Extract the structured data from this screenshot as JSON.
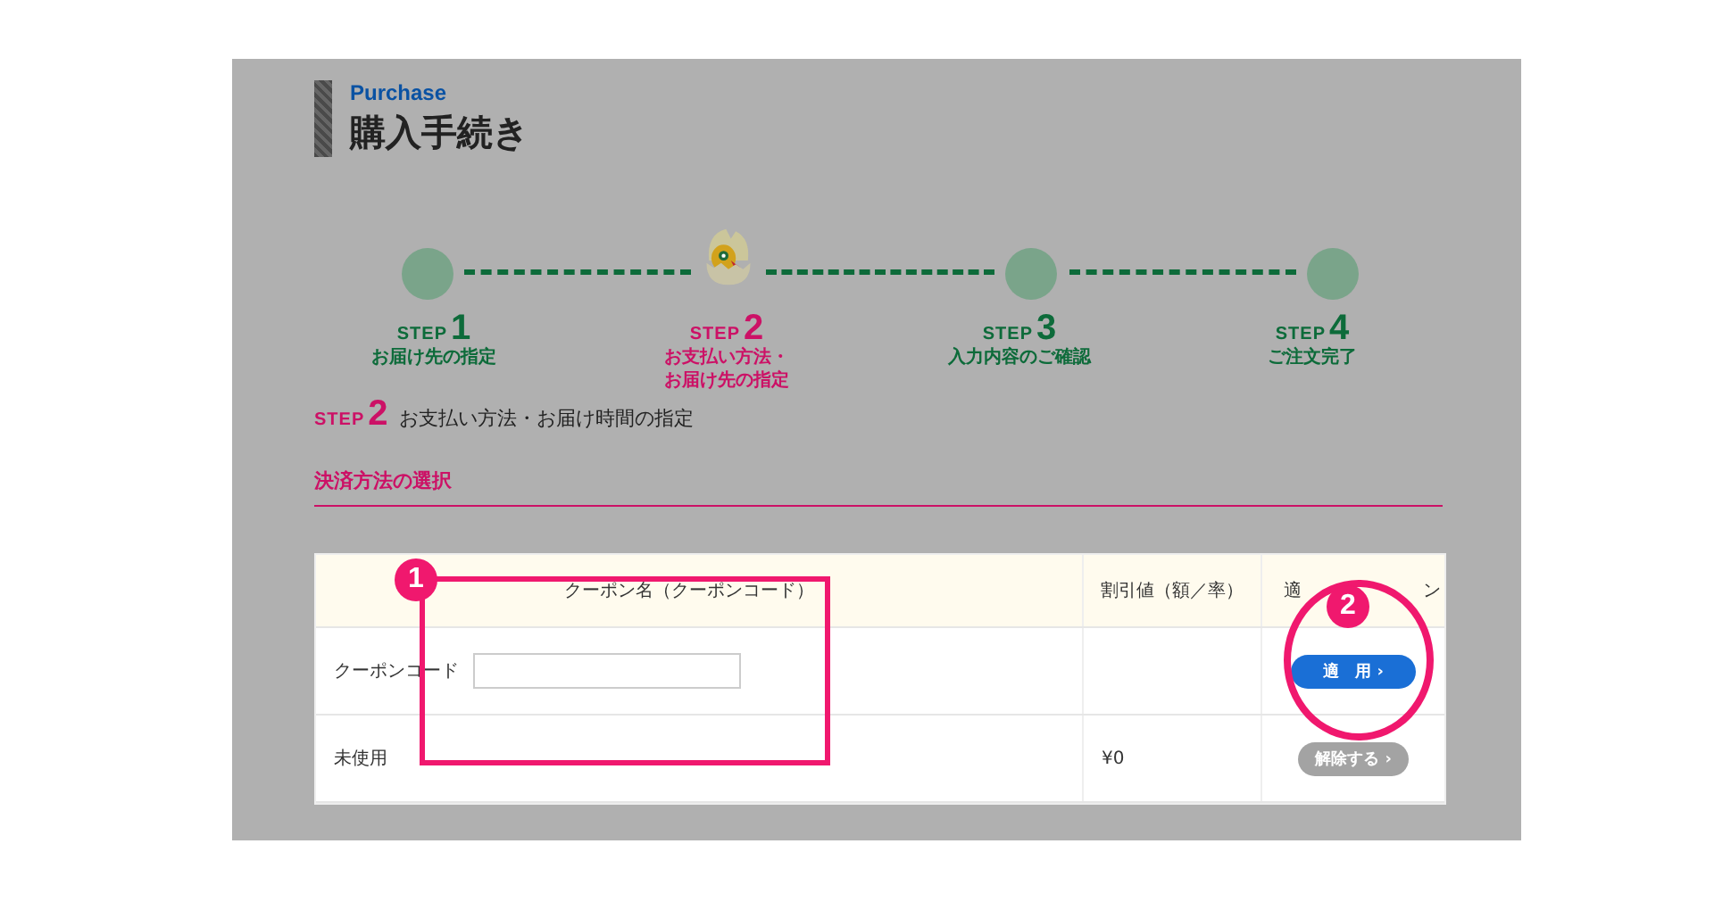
{
  "header": {
    "eyebrow": "Purchase",
    "title": "購入手続き"
  },
  "steps": [
    {
      "label": "STEP",
      "number": "1",
      "caption": "お届け先の指定",
      "selected": false
    },
    {
      "label": "STEP",
      "number": "2",
      "caption_lines": [
        "お支払い方法・",
        "お届け先の指定"
      ],
      "selected": true
    },
    {
      "label": "STEP",
      "number": "3",
      "caption": "入力内容のご確認",
      "selected": false
    },
    {
      "label": "STEP",
      "number": "4",
      "caption": "ご注文完了",
      "selected": false
    }
  ],
  "current_step": {
    "label": "STEP",
    "number": "2",
    "title": "お支払い方法・お届け時間の指定"
  },
  "section_title": "決済方法の選択",
  "table": {
    "columns": [
      "クーポン名（クーポンコード）",
      "割引値（額／率）"
    ],
    "column_3_parts": [
      "適",
      "ン"
    ],
    "rows": [
      {
        "kind": "input",
        "label": "クーポンコード",
        "value_text": "",
        "button": "適　用 ›"
      },
      {
        "kind": "text",
        "label": "未使用",
        "value_text": "¥0",
        "button": "解除する ›"
      }
    ]
  },
  "annotations": [
    {
      "number": "1",
      "kind": "rectangle"
    },
    {
      "number": "2",
      "kind": "circle"
    }
  ]
}
